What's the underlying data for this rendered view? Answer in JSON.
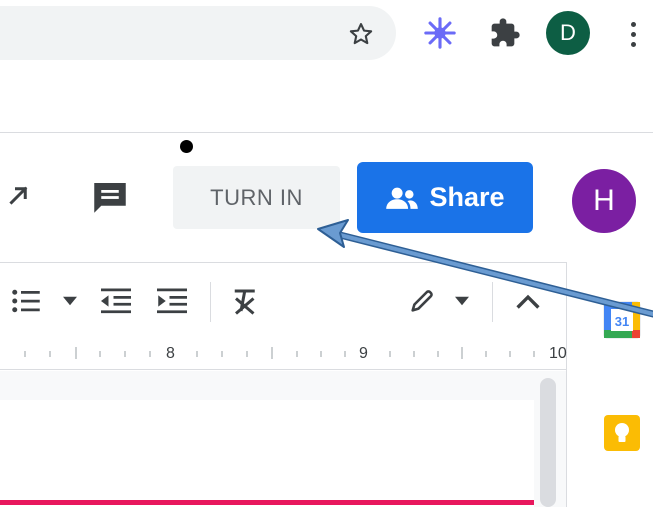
{
  "browser": {
    "bookmark_icon": "star-outline-icon",
    "extensions": [
      {
        "name": "ai-sparkle-extension",
        "icon": "sparkle-icon",
        "color": "#6b6bf7"
      },
      {
        "name": "extensions-menu",
        "icon": "puzzle-icon",
        "color": "#3c4043"
      }
    ],
    "profile": {
      "initial": "D",
      "color": "#0d5e44"
    },
    "menu_icon": "kebab-icon"
  },
  "doc_header": {
    "turn_in_label": "TURN IN",
    "share_label": "Share",
    "account_initial": "H",
    "account_color": "#7b1fa2",
    "share_color": "#1a73e8"
  },
  "ruler": {
    "labels": [
      "8",
      "9",
      "10"
    ]
  },
  "side_panel": {
    "apps": [
      {
        "name": "calendar",
        "label": "31"
      },
      {
        "name": "keep",
        "icon": "bulb-icon"
      }
    ]
  },
  "annotation": {
    "arrow_color": "#6a9bd1"
  }
}
